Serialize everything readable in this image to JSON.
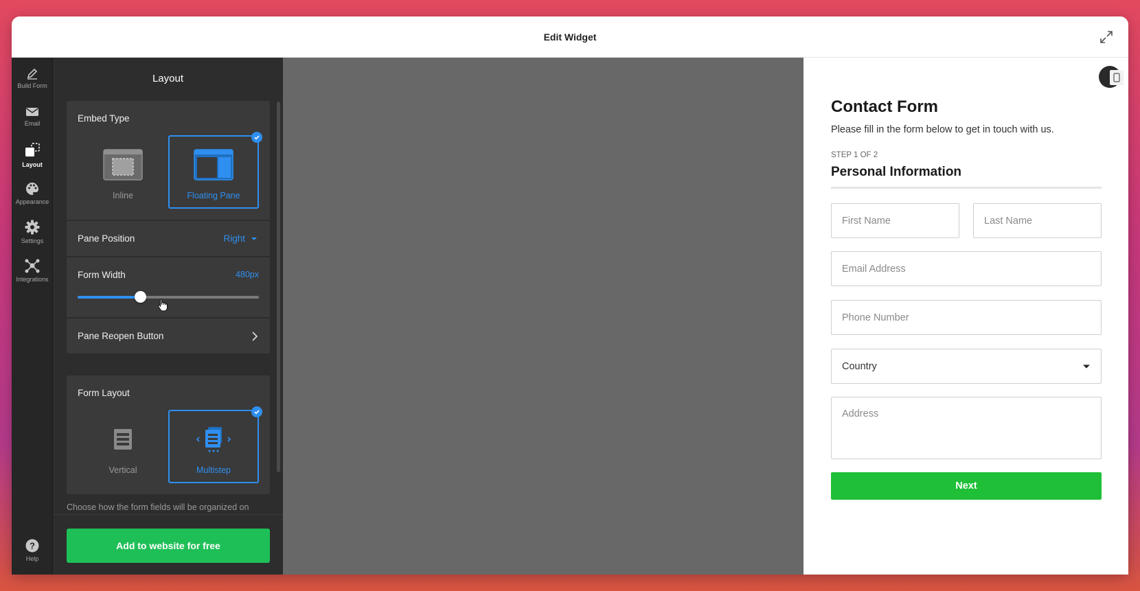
{
  "window": {
    "title": "Edit Widget"
  },
  "rail": {
    "items": [
      {
        "label": "Build Form",
        "icon": "pencil-icon"
      },
      {
        "label": "Email",
        "icon": "envelope-icon"
      },
      {
        "label": "Layout",
        "icon": "layout-icon",
        "active": true
      },
      {
        "label": "Appearance",
        "icon": "palette-icon"
      },
      {
        "label": "Settings",
        "icon": "gear-icon"
      },
      {
        "label": "Integrations",
        "icon": "integrations-icon"
      }
    ],
    "help_label": "Help"
  },
  "panel": {
    "title": "Layout",
    "embed_type": {
      "label": "Embed Type",
      "options": [
        {
          "label": "Inline",
          "selected": false
        },
        {
          "label": "Floating Pane",
          "selected": true
        }
      ]
    },
    "pane_position": {
      "label": "Pane Position",
      "value": "Right"
    },
    "form_width": {
      "label": "Form Width",
      "value": "480px",
      "slider_fraction": 0.345
    },
    "pane_reopen": {
      "label": "Pane Reopen Button"
    },
    "form_layout": {
      "label": "Form Layout",
      "options": [
        {
          "label": "Vertical",
          "selected": false
        },
        {
          "label": "Multistep",
          "selected": true
        }
      ]
    },
    "hint": "Choose how the form fields will be organized on",
    "add_button": "Add to website for free"
  },
  "form": {
    "title": "Contact Form",
    "subtitle": "Please fill in the form below to get in touch with us.",
    "step": "STEP 1 OF 2",
    "section": "Personal Information",
    "first_name": {
      "placeholder": "First Name"
    },
    "last_name": {
      "placeholder": "Last Name"
    },
    "email": {
      "placeholder": "Email Address"
    },
    "phone": {
      "placeholder": "Phone Number"
    },
    "country": {
      "value": "Country"
    },
    "address": {
      "placeholder": "Address"
    },
    "next_button": "Next"
  },
  "colors": {
    "accent": "#2f8ff0",
    "green": "#1fbf57",
    "next_green": "#1fbf37",
    "panel_bg": "#2d2d2d",
    "card_bg": "#3a3a3a",
    "preview_bg": "#686868"
  }
}
